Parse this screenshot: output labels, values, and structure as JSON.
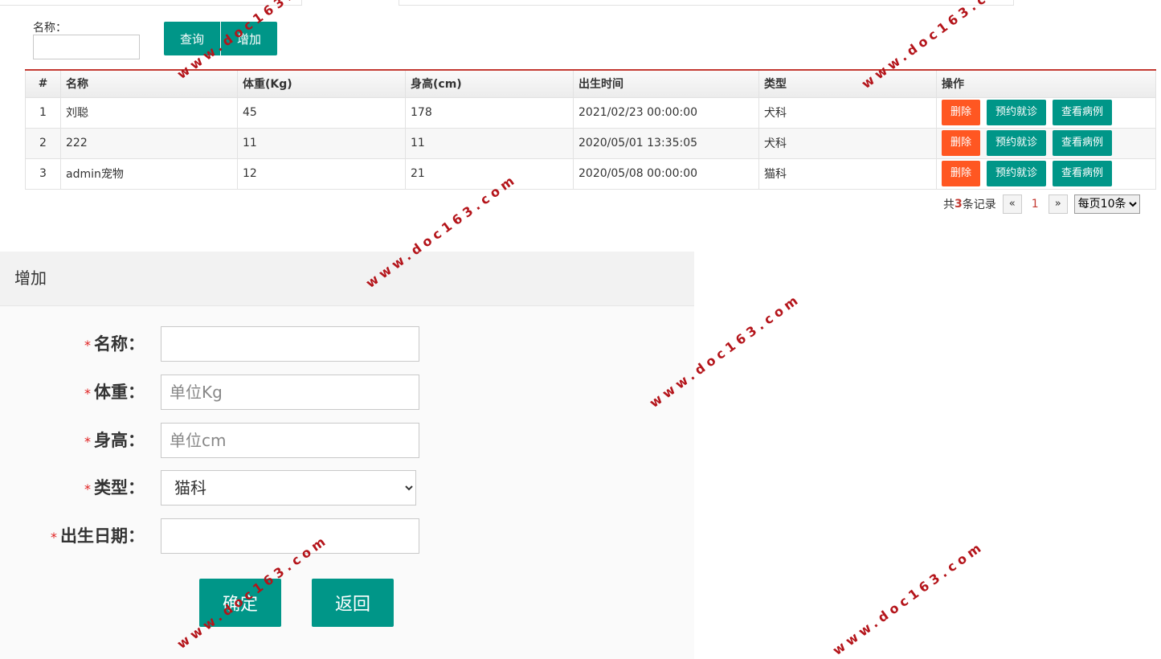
{
  "search": {
    "label": "名称：",
    "value": "",
    "query_button": "查询",
    "add_button": "增加"
  },
  "table": {
    "headers": [
      "#",
      "名称",
      "体重(Kg)",
      "身高(cm)",
      "出生时间",
      "类型",
      "操作"
    ],
    "rows": [
      {
        "index": "1",
        "name": "刘聪",
        "weight": "45",
        "height": "178",
        "birth": "2021/02/23 00:00:00",
        "type": "犬科"
      },
      {
        "index": "2",
        "name": "222",
        "weight": "11",
        "height": "11",
        "birth": "2020/05/01 13:35:05",
        "type": "犬科"
      },
      {
        "index": "3",
        "name": "admin宠物",
        "weight": "12",
        "height": "21",
        "birth": "2020/05/08 00:00:00",
        "type": "猫科"
      }
    ],
    "actions": {
      "delete": "删除",
      "appointment": "预约就诊",
      "view_cases": "查看病例"
    }
  },
  "pager": {
    "prefix": "共",
    "total": "3",
    "suffix": "条记录",
    "prev": "«",
    "current": "1",
    "next": "»",
    "page_size": "每页10条"
  },
  "add_form": {
    "title": "增加",
    "required_mark": "*",
    "name_label": "名称：",
    "name_value": "",
    "weight_label": "体重：",
    "weight_placeholder": "单位Kg",
    "height_label": "身高：",
    "height_placeholder": "单位cm",
    "type_label": "类型：",
    "type_value": "猫科",
    "birth_label": "出生日期：",
    "birth_value": "",
    "confirm_button": "确定",
    "back_button": "返回"
  },
  "watermark": "www.doc163.com",
  "colors": {
    "accent": "#009688",
    "danger": "#ff5722",
    "table_top_border": "#c43a32"
  }
}
